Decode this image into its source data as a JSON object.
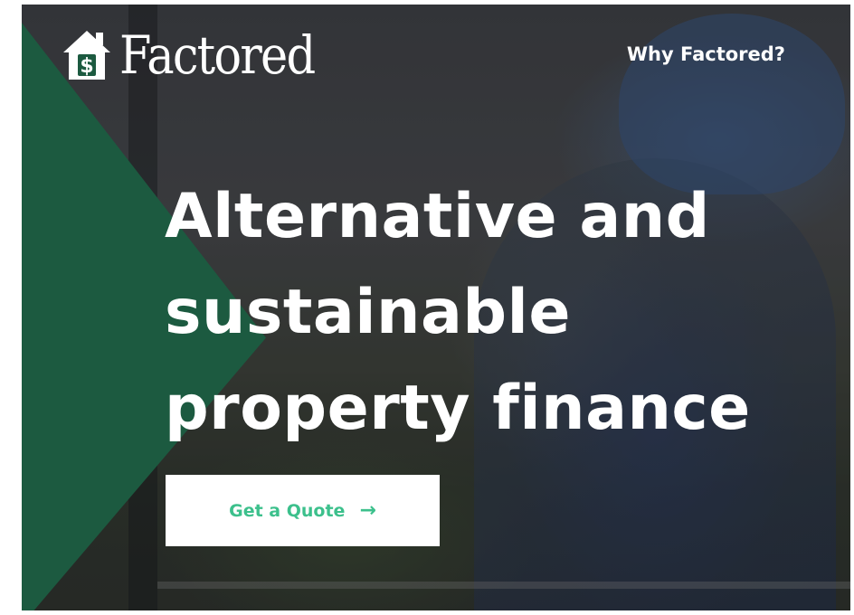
{
  "brand": {
    "name": "Factored",
    "logo_icon": "house-dollar-icon",
    "accent_color": "#1c5a40",
    "cta_text_color": "#3cc08c"
  },
  "nav": {
    "items": [
      {
        "label": "Why Factored?"
      }
    ]
  },
  "hero": {
    "headline_lines": [
      "Alternative and",
      "sustainable",
      "property finance"
    ],
    "cta": {
      "label": "Get a Quote",
      "icon": "arrow-right-icon",
      "arrow": "→"
    }
  }
}
